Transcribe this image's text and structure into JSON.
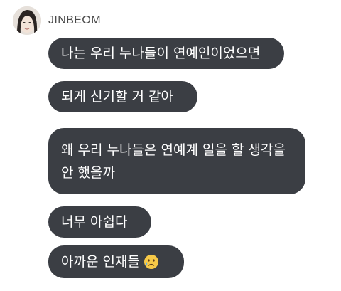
{
  "sender": {
    "name": "JINBEOM"
  },
  "messages": [
    {
      "text": "나는 우리 누나들이 연예인이었으면"
    },
    {
      "text": "되게 신기할 거 같아"
    },
    {
      "text": "왜 우리 누나들은 연예계 일을 할 생각을 안 했을까"
    },
    {
      "text": "너무 아쉽다"
    },
    {
      "text": "아까운 인재들",
      "emoji": "crying-face-emoji"
    }
  ],
  "colors": {
    "bubble_background": "#3b3e44",
    "bubble_text": "#ffffff",
    "name_text": "#4a4a4a"
  }
}
